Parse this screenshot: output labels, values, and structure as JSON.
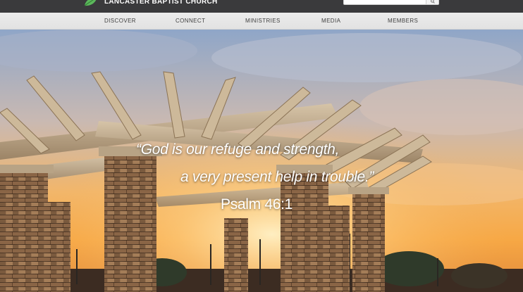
{
  "header": {
    "site_name": "LANCASTER BAPTIST CHURCH",
    "logo_icon": "leaf-icon",
    "search": {
      "placeholder": "",
      "value": "",
      "button_icon": "search-icon"
    }
  },
  "nav": {
    "items": [
      {
        "label": "DISCOVER"
      },
      {
        "label": "CONNECT"
      },
      {
        "label": "MINISTRIES"
      },
      {
        "label": "MEDIA"
      },
      {
        "label": "MEMBERS"
      }
    ]
  },
  "hero": {
    "quote_line1": "“God is our refuge and strength,",
    "quote_line2": "a very present help in trouble.”",
    "reference": "Psalm 46:1"
  },
  "colors": {
    "topbar": "#3a3a3c",
    "navbar": "#e6e6e6",
    "leaf_green": "#5cb85c"
  }
}
